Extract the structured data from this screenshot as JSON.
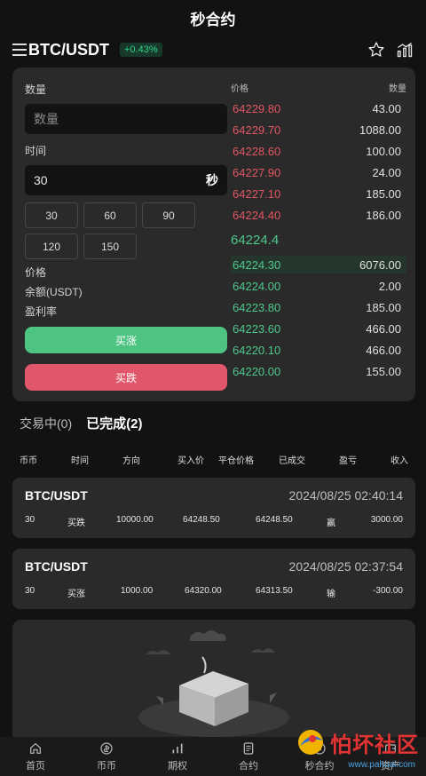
{
  "header": {
    "title": "秒合约"
  },
  "pair_bar": {
    "pair": "BTC/USDT",
    "change": "+0.43%"
  },
  "trade_form": {
    "quantity_label": "数量",
    "quantity_placeholder": "数量",
    "time_label": "时间",
    "time_value": "30",
    "time_unit": "秒",
    "durations": [
      "30",
      "60",
      "90",
      "120",
      "150"
    ],
    "price_label": "价格",
    "balance_label": "余额(USDT)",
    "profit_rate_label": "盈利率",
    "buy_up_label": "买涨",
    "buy_down_label": "买跌"
  },
  "order_book": {
    "price_header": "价格",
    "qty_header": "数量",
    "asks": [
      {
        "price": "64229.80",
        "qty": "43.00"
      },
      {
        "price": "64229.70",
        "qty": "1088.00"
      },
      {
        "price": "64228.60",
        "qty": "100.00"
      },
      {
        "price": "64227.90",
        "qty": "24.00"
      },
      {
        "price": "64227.10",
        "qty": "185.00"
      },
      {
        "price": "64224.40",
        "qty": "186.00"
      }
    ],
    "last_price": "64224.4",
    "bids": [
      {
        "price": "64224.30",
        "qty": "6076.00"
      },
      {
        "price": "64224.00",
        "qty": "2.00"
      },
      {
        "price": "64223.80",
        "qty": "185.00"
      },
      {
        "price": "64223.60",
        "qty": "466.00"
      },
      {
        "price": "64220.10",
        "qty": "466.00"
      },
      {
        "price": "64220.00",
        "qty": "155.00"
      }
    ]
  },
  "tabs": {
    "trading": "交易中(0)",
    "completed": "已完成(2)"
  },
  "columns": [
    "币币",
    "时间",
    "方向",
    "买入价",
    "平仓价格",
    "已成交",
    "盈亏",
    "收入"
  ],
  "orders": [
    {
      "pair": "BTC/USDT",
      "timestamp": "2024/08/25 02:40:14",
      "cells": [
        "30",
        "买跌",
        "10000.00",
        "64248.50",
        "64248.50",
        "赢",
        "3000.00"
      ]
    },
    {
      "pair": "BTC/USDT",
      "timestamp": "2024/08/25 02:37:54",
      "cells": [
        "30",
        "买涨",
        "1000.00",
        "64320.00",
        "64313.50",
        "输",
        "-300.00"
      ]
    }
  ],
  "bottom_nav": {
    "items": [
      {
        "label": "首页",
        "icon": "home-icon"
      },
      {
        "label": "币币",
        "icon": "coin-icon"
      },
      {
        "label": "期权",
        "icon": "bars-icon"
      },
      {
        "label": "合约",
        "icon": "contract-icon"
      },
      {
        "label": "秒合约",
        "icon": "clock-icon"
      },
      {
        "label": "资产",
        "icon": "wallet-icon"
      }
    ]
  },
  "watermark": {
    "text": "怕坏社区",
    "url": "www.pahuai.com"
  },
  "colors": {
    "up": "#4ec482",
    "down": "#e0566a",
    "bg": "#121212",
    "panel": "#2a2a2a"
  }
}
